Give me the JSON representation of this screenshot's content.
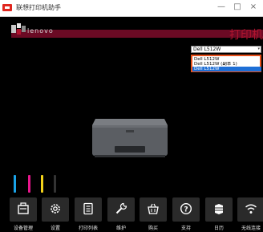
{
  "window": {
    "title": "联想打印机助手",
    "minimize": "—",
    "maximize": "□",
    "close": "×"
  },
  "banner": {
    "brand": "lenovo",
    "headline": "打印机"
  },
  "printer_select": {
    "selected": "Dell L512W",
    "arrow": "▾",
    "options": [
      "Dell L512W",
      "Dell L512W (副本 1)",
      "Dell L512W"
    ]
  },
  "ink_levels": [
    {
      "color": "#1aa3e8",
      "level": 1.0
    },
    {
      "color": "#e8168c",
      "level": 1.0
    },
    {
      "color": "#f2d21a",
      "level": 1.0
    },
    {
      "color": "#333333",
      "level": 1.0
    }
  ],
  "toolbar": {
    "items": [
      {
        "label": "设备管理",
        "icon": "device-management-icon"
      },
      {
        "label": "设置",
        "icon": "gear-icon"
      },
      {
        "label": "打印列表",
        "icon": "print-list-icon"
      },
      {
        "label": "维护",
        "icon": "wrench-icon"
      },
      {
        "label": "购买",
        "icon": "shopping-basket-icon"
      },
      {
        "label": "支持",
        "icon": "help-icon"
      },
      {
        "label": "日历",
        "icon": "calendar-icon"
      },
      {
        "label": "无线连接",
        "icon": "wifi-icon"
      }
    ]
  }
}
